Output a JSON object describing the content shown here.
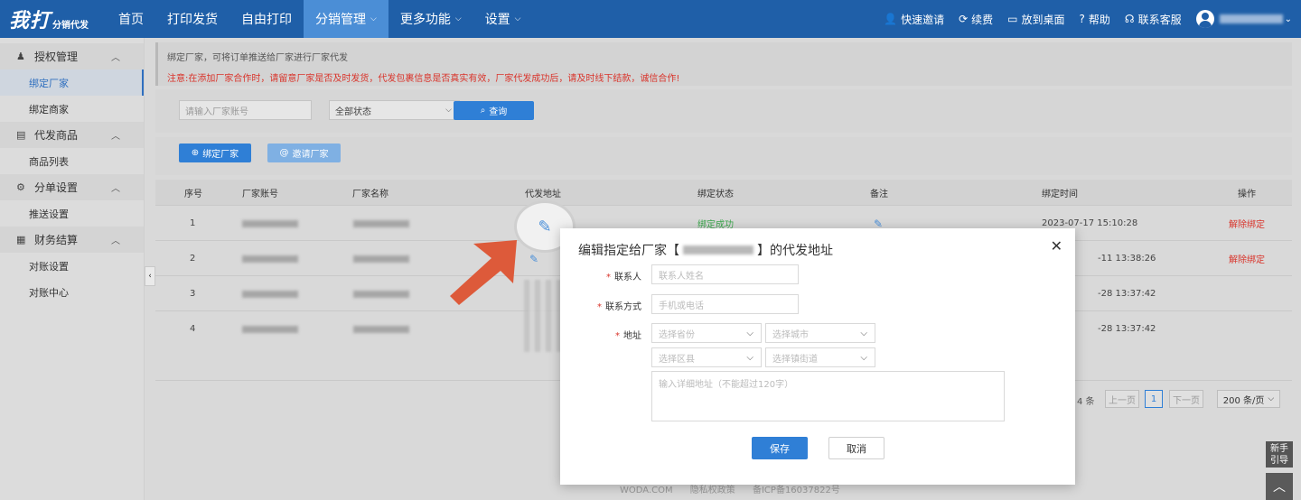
{
  "logo": {
    "main": "我打",
    "sub": "分销代发"
  },
  "nav": {
    "items": [
      {
        "label": "首页"
      },
      {
        "label": "打印发货"
      },
      {
        "label": "自由打印"
      },
      {
        "label": "分销管理",
        "caret": "⌵"
      },
      {
        "label": "更多功能",
        "caret": "⌵"
      },
      {
        "label": "设置",
        "caret": "⌵"
      }
    ]
  },
  "top_right": {
    "invite": "快速邀请",
    "renew": "续费",
    "desktop": "放到桌面",
    "help": "帮助",
    "service": "联系客服",
    "user_caret": "⌄"
  },
  "sidebar": {
    "groups": [
      {
        "label": "授权管理",
        "icon": "♟",
        "items": [
          "绑定厂家",
          "绑定商家"
        ]
      },
      {
        "label": "代发商品",
        "icon": "▤",
        "items": [
          "商品列表"
        ]
      },
      {
        "label": "分单设置",
        "icon": "⚙",
        "items": [
          "推送设置"
        ]
      },
      {
        "label": "财务结算",
        "icon": "▦",
        "items": [
          "对账设置",
          "对账中心"
        ]
      }
    ]
  },
  "notice": {
    "line1": "绑定厂家，可将订单推送给厂家进行厂家代发",
    "line2": "注意:在添加厂家合作时，请留意厂家是否及时发货，代发包裹信息是否真实有效，厂家代发成功后，请及时线下结款，诚信合作!"
  },
  "filter": {
    "account_placeholder": "请输入厂家账号",
    "status_value": "全部状态",
    "query_label": "查询"
  },
  "actions": {
    "bind": "绑定厂家",
    "invite": "邀请厂家"
  },
  "table": {
    "headers": [
      "序号",
      "厂家账号",
      "厂家名称",
      "代发地址",
      "绑定状态",
      "备注",
      "绑定时间",
      "操作"
    ],
    "rows": [
      {
        "no": "1",
        "status": "绑定成功",
        "time": "2023-07-17 15:10:28",
        "op": "解除绑定"
      },
      {
        "no": "2",
        "status": "",
        "time": "-11 13:38:26",
        "op": "解除绑定"
      },
      {
        "no": "3",
        "status": "",
        "time": "-28 13:37:42",
        "op": ""
      },
      {
        "no": "4",
        "status": "",
        "time": "-28 13:37:42",
        "op": ""
      }
    ]
  },
  "pagination": {
    "total": "4 条",
    "prev": "上一页",
    "current": "1",
    "next": "下一页",
    "size": "200 条/页"
  },
  "footer": {
    "a": "WODA.COM",
    "b": "隐私权政策",
    "c": "备ICP备16037822号"
  },
  "modal": {
    "title_prefix": "编辑指定给厂家【",
    "title_suffix": "】的代发地址",
    "contact_label": "联系人",
    "contact_placeholder": "联系人姓名",
    "phone_label": "联系方式",
    "phone_placeholder": "手机或电话",
    "address_label": "地址",
    "province": "选择省份",
    "city": "选择城市",
    "district": "选择区县",
    "street": "选择镇街道",
    "detail_placeholder": "输入详细地址（不能超过120字）",
    "save": "保存",
    "cancel": "取消",
    "close": "✕"
  },
  "float": {
    "newbie_l1": "新手",
    "newbie_l2": "引导",
    "totop": "︿"
  },
  "colors": {
    "nav_bg": "#1f5fa8",
    "primary": "#2f7fd6",
    "danger": "#d9342b",
    "success": "#3aa64b",
    "arrow": "#dd5a3a"
  }
}
